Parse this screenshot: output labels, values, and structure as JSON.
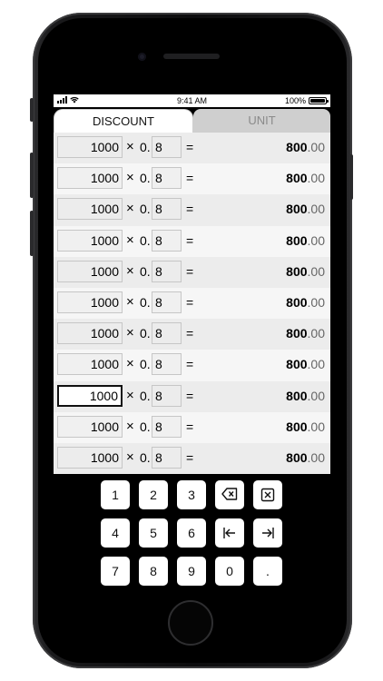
{
  "status_bar": {
    "time": "9:41 AM",
    "battery": "100%"
  },
  "tabs": [
    {
      "label": "DISCOUNT",
      "active": true
    },
    {
      "label": "UNIT",
      "active": false
    }
  ],
  "rows": [
    {
      "amount": "1000",
      "times": "×",
      "rate_prefix": "0.",
      "rate": "8",
      "equals": "=",
      "result_int": "800",
      "result_dec": ".00"
    },
    {
      "amount": "1000",
      "times": "×",
      "rate_prefix": "0.",
      "rate": "8",
      "equals": "=",
      "result_int": "800",
      "result_dec": ".00"
    },
    {
      "amount": "1000",
      "times": "×",
      "rate_prefix": "0.",
      "rate": "8",
      "equals": "=",
      "result_int": "800",
      "result_dec": ".00"
    },
    {
      "amount": "1000",
      "times": "×",
      "rate_prefix": "0.",
      "rate": "8",
      "equals": "=",
      "result_int": "800",
      "result_dec": ".00"
    },
    {
      "amount": "1000",
      "times": "×",
      "rate_prefix": "0.",
      "rate": "8",
      "equals": "=",
      "result_int": "800",
      "result_dec": ".00"
    },
    {
      "amount": "1000",
      "times": "×",
      "rate_prefix": "0.",
      "rate": "8",
      "equals": "=",
      "result_int": "800",
      "result_dec": ".00"
    },
    {
      "amount": "1000",
      "times": "×",
      "rate_prefix": "0.",
      "rate": "8",
      "equals": "=",
      "result_int": "800",
      "result_dec": ".00"
    },
    {
      "amount": "1000",
      "times": "×",
      "rate_prefix": "0.",
      "rate": "8",
      "equals": "=",
      "result_int": "800",
      "result_dec": ".00"
    },
    {
      "amount": "1000",
      "times": "×",
      "rate_prefix": "0.",
      "rate": "8",
      "equals": "=",
      "result_int": "800",
      "result_dec": ".00"
    },
    {
      "amount": "1000",
      "times": "×",
      "rate_prefix": "0.",
      "rate": "8",
      "equals": "=",
      "result_int": "800",
      "result_dec": ".00"
    },
    {
      "amount": "1000",
      "times": "×",
      "rate_prefix": "0.",
      "rate": "8",
      "equals": "=",
      "result_int": "800",
      "result_dec": ".00"
    }
  ],
  "keypad": {
    "row1": [
      "1",
      "2",
      "3"
    ],
    "row2": [
      "4",
      "5",
      "6"
    ],
    "row3": [
      "7",
      "8",
      "9",
      "0",
      "."
    ],
    "icons": [
      "backspace-icon",
      "clear-icon",
      "move-left-icon",
      "move-right-icon"
    ]
  },
  "colors": {
    "active_tab": "#ffffff",
    "inactive_tab": "#cfcfcf",
    "row_odd": "#ececec",
    "row_even": "#f6f6f6"
  }
}
